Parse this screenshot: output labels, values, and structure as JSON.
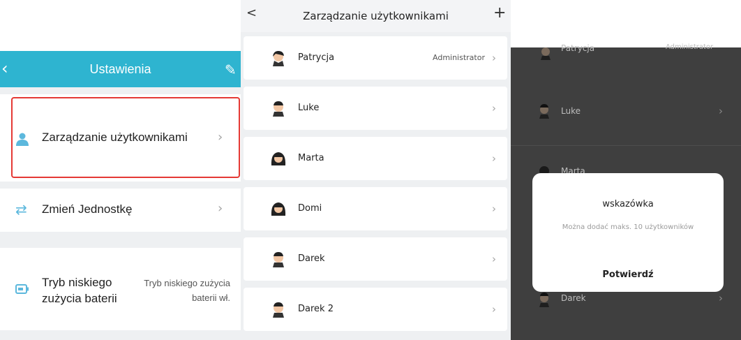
{
  "settings": {
    "title": "Ustawienia",
    "items": [
      {
        "label": "Zarządzanie użytkownikami",
        "icon": "user-icon"
      },
      {
        "label": "Zmień Jednostkę",
        "icon": "switch-arrows-icon"
      },
      {
        "label_line1": "Tryb niskiego",
        "label_line2": "zużycia baterii",
        "value_line1": "Tryb niskiego zużycia",
        "value_line2": "baterii wł.",
        "icon": "battery-icon"
      }
    ],
    "accent": "#2eb4d0",
    "highlight_color": "#e53935"
  },
  "users": {
    "title": "Zarządzanie użytkownikami",
    "list": [
      {
        "name": "Patrycja",
        "role": "Administrator"
      },
      {
        "name": "Luke",
        "role": ""
      },
      {
        "name": "Marta",
        "role": ""
      },
      {
        "name": "Domi",
        "role": ""
      },
      {
        "name": "Darek",
        "role": ""
      },
      {
        "name": "Darek 2",
        "role": ""
      }
    ]
  },
  "overlay": {
    "bg_names": [
      "Patrycja",
      "Luke",
      "Marta",
      "Darek"
    ],
    "bg_role": "Administrator",
    "dialog": {
      "title": "wskazówka",
      "message": "Można dodać maks. 10 użytkowników",
      "confirm": "Potwierdź"
    }
  }
}
